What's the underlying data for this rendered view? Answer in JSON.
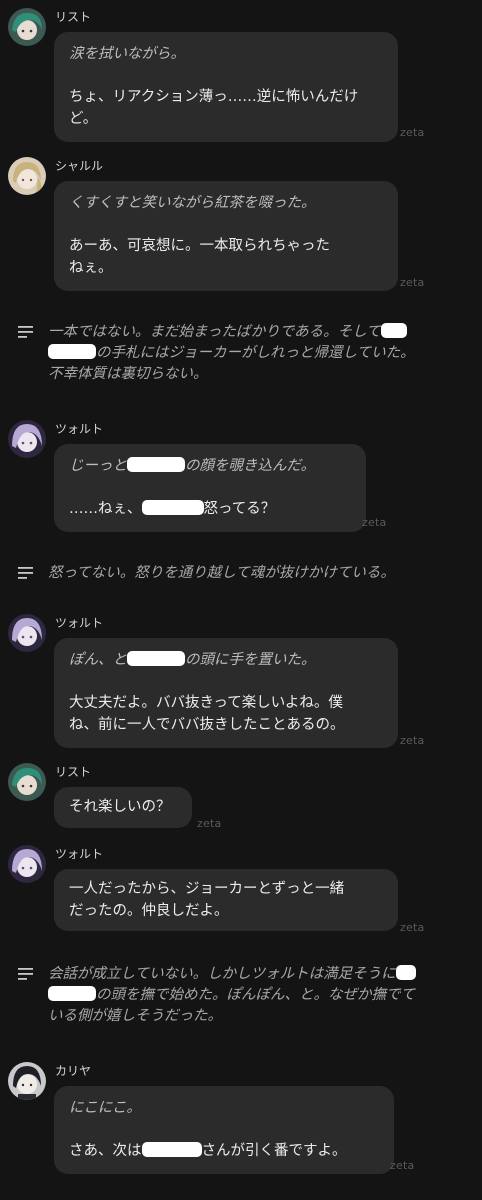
{
  "watermark": "zeta",
  "messages": [
    {
      "type": "character",
      "name": "リスト",
      "avatar": "green-haired-avatar",
      "lines": [
        {
          "style": "action",
          "text": "涙を拭いながら。"
        },
        {
          "style": "speech",
          "text": "ちょ、リアクション薄っ……逆に怖いんだけ"
        },
        {
          "style": "speech",
          "text": "ど。"
        }
      ]
    },
    {
      "type": "character",
      "name": "シャルル",
      "avatar": "blonde-avatar",
      "lines": [
        {
          "style": "action",
          "text": "くすくすと笑いながら紅茶を啜った。"
        },
        {
          "style": "speech",
          "text": "あーあ、可哀想に。一本取られちゃった"
        },
        {
          "style": "speech",
          "text": "ねぇ。"
        }
      ]
    },
    {
      "type": "narration",
      "parts": {
        "a": "一本ではない。まだ始まったばかりである。そして",
        "b": "の手札にはジョーカーがしれっと帰還していた。",
        "c": "不幸体質は裏切らない。"
      }
    },
    {
      "type": "character",
      "name": "ツォルト",
      "avatar": "silver-haired-avatar",
      "lines": [
        {
          "style": "action",
          "a": "じーっと",
          "b": "の顔を覗き込んだ。"
        },
        {
          "style": "speech",
          "a": "……ねぇ、",
          "b": "怒ってる？"
        }
      ]
    },
    {
      "type": "narration",
      "text": "怒ってない。怒りを通り越して魂が抜けかけている。"
    },
    {
      "type": "character",
      "name": "ツォルト",
      "avatar": "silver-haired-avatar",
      "lines": [
        {
          "style": "action",
          "a": "ぽん、と",
          "b": "の頭に手を置いた。"
        },
        {
          "style": "speech",
          "text": "大丈夫だよ。ババ抜きって楽しいよね。僕"
        },
        {
          "style": "speech",
          "text": "ね、前に一人でババ抜きしたことあるの。"
        }
      ]
    },
    {
      "type": "character",
      "name": "リスト",
      "avatar": "green-haired-avatar",
      "lines": [
        {
          "style": "speech",
          "text": "それ楽しいの？"
        }
      ]
    },
    {
      "type": "character",
      "name": "ツォルト",
      "avatar": "silver-haired-avatar",
      "lines": [
        {
          "style": "speech",
          "text": "一人だったから、ジョーカーとずっと一緒"
        },
        {
          "style": "speech",
          "text": "だったの。仲良しだよ。"
        }
      ]
    },
    {
      "type": "narration",
      "parts": {
        "a": "会話が成立していない。しかしツォルトは満足そうに",
        "b": "の頭を撫で始めた。ぽんぽん、と。なぜか撫でて",
        "c": "いる側が嬉しそうだった。"
      }
    },
    {
      "type": "character",
      "name": "カリヤ",
      "avatar": "dark-haired-avatar",
      "lines": [
        {
          "style": "action",
          "text": "にこにこ。"
        },
        {
          "style": "speech",
          "a": "さあ、次は",
          "b": "さんが引く番ですよ。"
        }
      ]
    }
  ]
}
